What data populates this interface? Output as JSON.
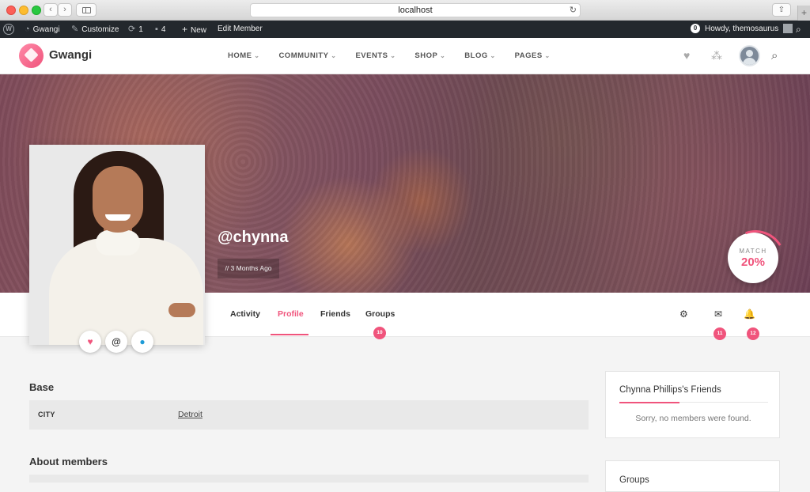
{
  "browser": {
    "url": "localhost"
  },
  "adminbar": {
    "site_name": "Gwangi",
    "customize": "Customize",
    "updates_count": "1",
    "comments_count": "4",
    "new_label": "New",
    "edit_member": "Edit Member",
    "notifications_count": "0",
    "greeting": "Howdy, themosaurus"
  },
  "header": {
    "brand": "Gwangi",
    "nav": [
      {
        "label": "HOME"
      },
      {
        "label": "COMMUNITY"
      },
      {
        "label": "EVENTS"
      },
      {
        "label": "SHOP"
      },
      {
        "label": "BLOG"
      },
      {
        "label": "PAGES"
      }
    ]
  },
  "profile": {
    "username": "@chynna",
    "last_active": "// 3 Months Ago",
    "match_label": "MATCH",
    "match_value": "20%",
    "match_fraction": 0.2
  },
  "tabs": [
    {
      "label": "Activity"
    },
    {
      "label": "Profile",
      "active": true
    },
    {
      "label": "Friends"
    },
    {
      "label": "Groups",
      "badge": "10"
    }
  ],
  "tools": {
    "messages_badge": "11",
    "notifications_badge": "12"
  },
  "main": {
    "base_title": "Base",
    "fields": [
      {
        "name": "CITY",
        "value": "Detroit"
      }
    ],
    "about_title": "About members"
  },
  "sidebar": {
    "friends_title": "Chynna Phillips's Friends",
    "friends_empty": "Sorry, no members were found.",
    "groups_title": "Groups"
  },
  "colors": {
    "accent": "#f0547c",
    "adminbar": "#23282d"
  }
}
